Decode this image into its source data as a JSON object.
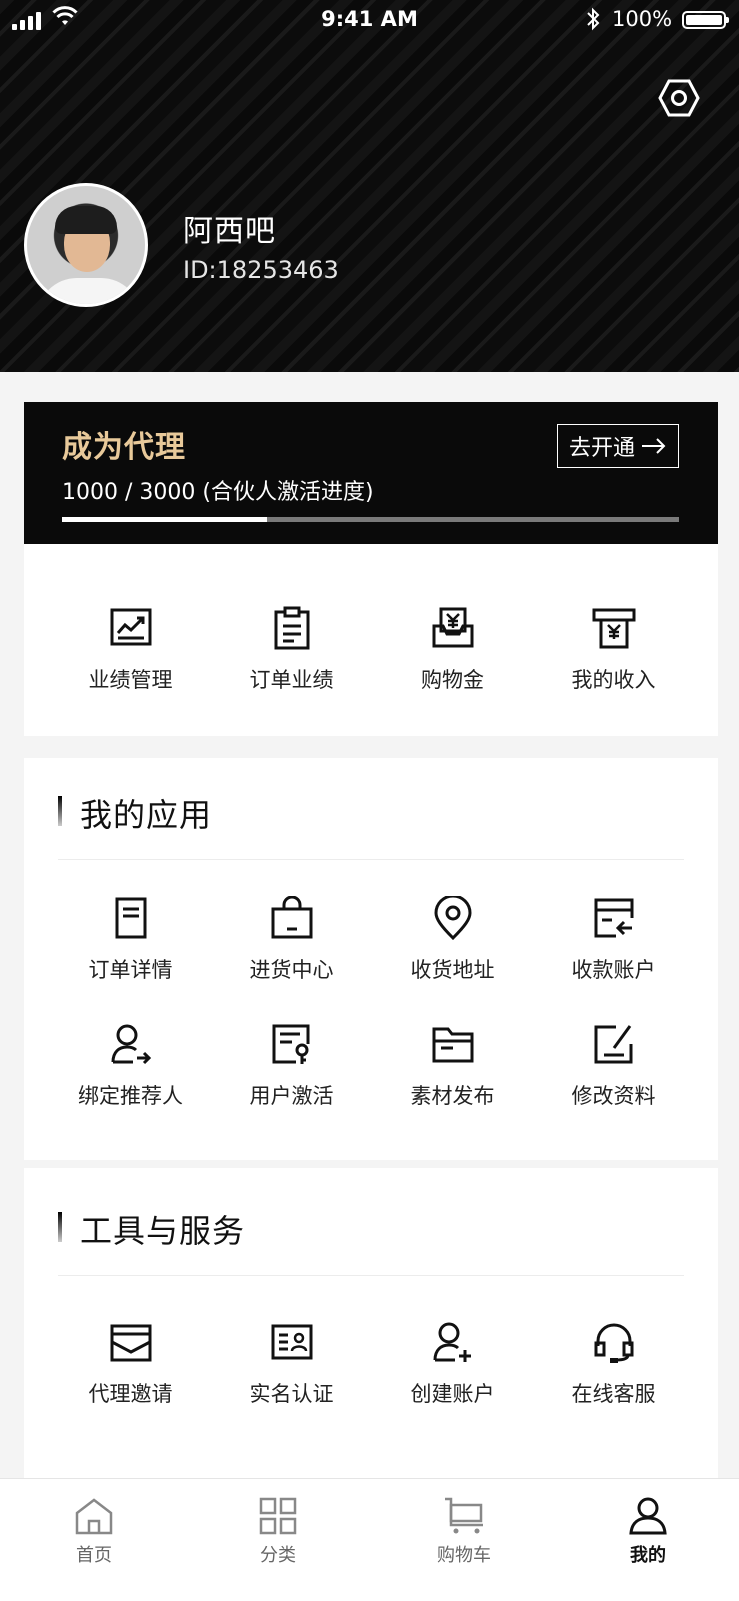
{
  "status_bar": {
    "time": "9:41 AM",
    "battery": "100%"
  },
  "profile": {
    "name": "阿西吧",
    "id": "ID:18253463"
  },
  "agent_banner": {
    "title": "成为代理",
    "progress_text": "1000 / 3000 (合伙人激活进度)",
    "progress_fraction": 0.333,
    "button_label": "去开通"
  },
  "quick_actions": [
    {
      "label": "业绩管理",
      "icon": "chart-trend-icon"
    },
    {
      "label": "订单业绩",
      "icon": "clipboard-icon"
    },
    {
      "label": "购物金",
      "icon": "yen-tray-icon"
    },
    {
      "label": "我的收入",
      "icon": "atm-yen-icon"
    }
  ],
  "my_apps": {
    "title": "我的应用",
    "items": [
      {
        "label": "订单详情",
        "icon": "document-icon"
      },
      {
        "label": "进货中心",
        "icon": "shopping-bag-icon"
      },
      {
        "label": "收货地址",
        "icon": "location-pin-icon"
      },
      {
        "label": "收款账户",
        "icon": "card-transfer-icon"
      },
      {
        "label": "绑定推荐人",
        "icon": "user-arrow-icon"
      },
      {
        "label": "用户激活",
        "icon": "key-card-icon"
      },
      {
        "label": "素材发布",
        "icon": "folder-icon"
      },
      {
        "label": "修改资料",
        "icon": "edit-icon"
      }
    ]
  },
  "tools": {
    "title": "工具与服务",
    "items": [
      {
        "label": "代理邀请",
        "icon": "invite-envelope-icon"
      },
      {
        "label": "实名认证",
        "icon": "id-card-icon"
      },
      {
        "label": "创建账户",
        "icon": "user-add-icon"
      },
      {
        "label": "在线客服",
        "icon": "headset-icon"
      }
    ]
  },
  "tabbar": [
    {
      "label": "首页",
      "icon": "home-icon",
      "active": false
    },
    {
      "label": "分类",
      "icon": "grid-icon",
      "active": false
    },
    {
      "label": "购物车",
      "icon": "cart-icon",
      "active": false
    },
    {
      "label": "我的",
      "icon": "user-icon",
      "active": true
    }
  ]
}
